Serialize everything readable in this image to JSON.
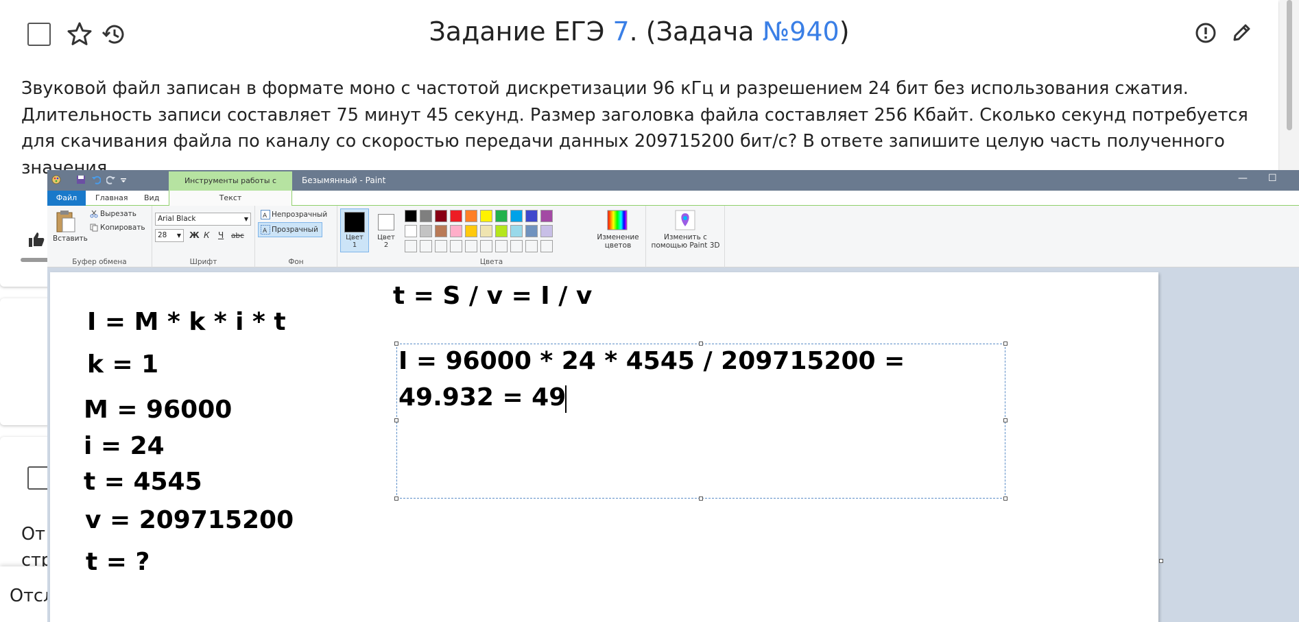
{
  "page": {
    "title_prefix": "Задание ЕГЭ ",
    "title_task_num": "7",
    "title_mid": ". (Задача ",
    "title_task_link": "№940",
    "title_suffix": ")",
    "problem_lines": [
      "Звуковой файл записан в формате моно с частотой дискретизации 96 кГц и разрешением 24 бит без использования сжатия.",
      "Длительность записи составляет 75 минут 45 секунд. Размер заголовка файла составляет 256 Кбайт. Сколько секунд потребуется",
      "для скачивания файла по каналу со скоростью передачи данных 209715200 бит/с? В ответе запишите целую часть полученного",
      "значения."
    ],
    "answer_frag_lines": [
      "От",
      "стр"
    ],
    "bottom_popup": "Отсл"
  },
  "paint": {
    "window_title": "Безымянный - Paint",
    "context_tab": "Инструменты работы с текстом",
    "tabs": {
      "file": "Файл",
      "home": "Главная",
      "view": "Вид",
      "text": "Текст"
    },
    "clipboard": {
      "paste": "Вставить",
      "cut": "Вырезать",
      "copy": "Копировать",
      "label": "Буфер обмена"
    },
    "font": {
      "family": "Arial Black",
      "size": "28",
      "bold": "Ж",
      "italic": "К",
      "underline": "Ч",
      "strike": "abc",
      "label": "Шрифт"
    },
    "background": {
      "opaque": "Непрозрачный",
      "transparent": "Прозрачный",
      "label": "Фон"
    },
    "colors": {
      "color1": "Цвет 1",
      "color1_b": "",
      "color1_line1": "Цвет",
      "color1_line2": "1",
      "color2_line1": "Цвет",
      "color2_line2": "2",
      "edit_line1": "Изменение",
      "edit_line2": "цветов",
      "label": "Цвета",
      "row1": [
        "#000000",
        "#7f7f7f",
        "#880015",
        "#ed1c24",
        "#ff7f27",
        "#fff200",
        "#22b14c",
        "#00a2e8",
        "#3f48cc",
        "#a349a4"
      ],
      "row2": [
        "#ffffff",
        "#c3c3c3",
        "#b97a57",
        "#ffaec9",
        "#ffc90e",
        "#efe4b0",
        "#b5e61d",
        "#99d9ea",
        "#7092be",
        "#c8bfe7"
      ]
    },
    "paint3d": {
      "line1": "Изменить с",
      "line2": "помощью Paint 3D"
    },
    "canvas_text": {
      "formula_i": "I = M * k * i * t",
      "k": "k = 1",
      "m": "M = 96000",
      "i": "i = 24",
      "t": "t = 4545",
      "v": "v = 209715200",
      "t_q": "t = ?",
      "formula_t": "t = S / v = I / v",
      "calc_line1": "I = 96000 * 24 * 4545 / 209715200 =",
      "calc_line2": "49.932 = 49"
    }
  }
}
